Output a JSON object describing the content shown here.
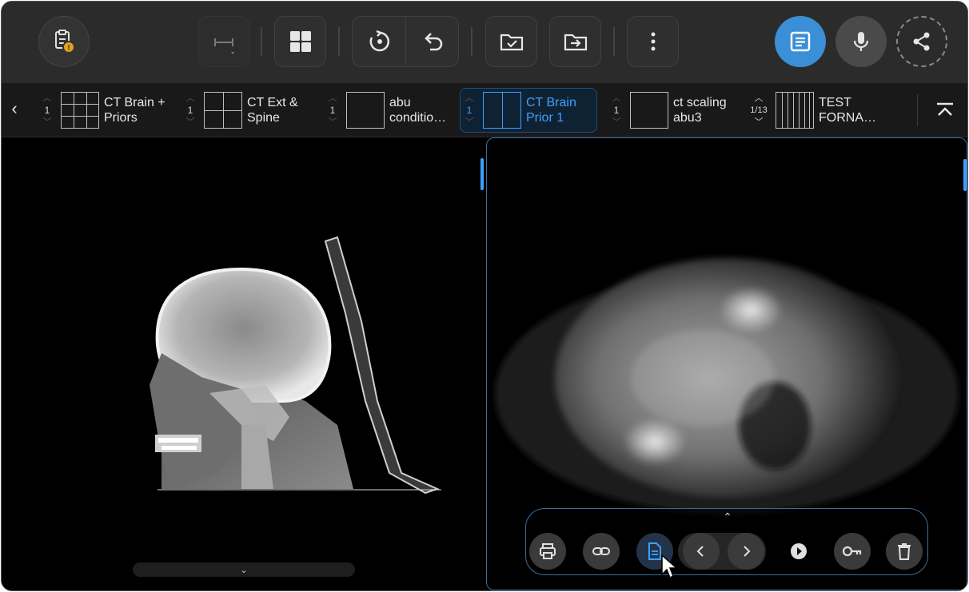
{
  "toolbar": {
    "items": [
      "clipboard-alert-icon",
      "measure-icon",
      "layout-grid-icon",
      "rotate-icon",
      "undo-icon",
      "folder-check-icon",
      "folder-export-icon",
      "more-vertical-icon",
      "report-icon",
      "microphone-icon",
      "share-icon"
    ],
    "accent": "#3a8fd6"
  },
  "protocols": {
    "nav_left": "‹",
    "collapse": "⌃",
    "items": [
      {
        "count": "1",
        "label": "CT Brain +\nPriors",
        "layout": "3x3"
      },
      {
        "count": "1",
        "label": "CT Ext &\nSpine",
        "layout": "2x2"
      },
      {
        "count": "1",
        "label": "abu\nconditio…",
        "layout": "1x1"
      },
      {
        "count": "1",
        "label": "CT Brain\nPrior 1",
        "layout": "1x2",
        "active": true
      },
      {
        "count": "1",
        "label": "ct scaling\nabu3",
        "layout": "1x1"
      },
      {
        "count": "1/13",
        "label": "TEST\nFORNA…",
        "layout": "stack"
      }
    ]
  },
  "viewer": {
    "left_series_chevron": "⌄",
    "active_color": "#3a6ea0"
  },
  "action_bar": {
    "expand": "⌃",
    "buttons": [
      "print-icon",
      "link-icon",
      "report-document-icon",
      "prev-icon",
      "next-icon",
      "play-icon",
      "key-icon",
      "trash-icon"
    ]
  }
}
